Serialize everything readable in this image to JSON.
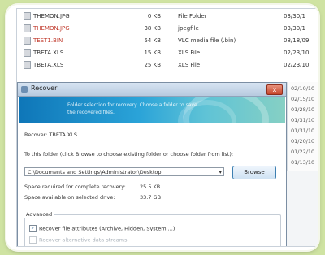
{
  "files": [
    {
      "name": "THEMON.JPG",
      "size": "0 KB",
      "type": "File Folder",
      "date": "03/30/1",
      "color": "#333333"
    },
    {
      "name": "THEMON.JPG",
      "size": "38 KB",
      "type": "jpegfile",
      "date": "03/30/1",
      "color": "#c0392b"
    },
    {
      "name": "TEST1.BIN",
      "size": "54 KB",
      "type": "VLC media file (.bin)",
      "date": "08/18/09",
      "color": "#c0392b"
    },
    {
      "name": "TBETA.XLS",
      "size": "15 KB",
      "type": "XLS File",
      "date": "02/23/10",
      "color": "#333333"
    },
    {
      "name": "TBETA.XLS",
      "size": "25 KB",
      "type": "XLS File",
      "date": "02/23/10",
      "color": "#333333"
    }
  ],
  "side_dates": [
    "02/10/10",
    "02/15/10",
    "01/28/10",
    "01/31/10",
    "01/31/10",
    "01/20/10",
    "01/22/10",
    "01/13/10"
  ],
  "dialog": {
    "title": "Recover",
    "close_label": "x",
    "banner_text": "Folder selection for recovery. Choose a folder to save the recovered files.",
    "recover_line": "Recover: TBETA.XLS",
    "instruction": "To this folder (click Browse to choose existing folder or choose folder from list):",
    "path_value": "C:\\Documents and Settings\\Administrator\\Desktop",
    "browse_label": "Browse",
    "space_required_label": "Space required for complete recovery:",
    "space_required_value": "25.5 KB",
    "space_available_label": "Space available on selected drive:",
    "space_available_value": "33.7 GB",
    "advanced_label": "Advanced",
    "opt_attributes": "Recover file attributes (Archive, Hidden, System ...)",
    "opt_streams": "Recover alternative data streams"
  },
  "colors": {
    "banner_start": "#0e76b8",
    "banner_end": "#86d0c4",
    "close_button": "#c5442a",
    "deleted_file": "#c0392b"
  }
}
